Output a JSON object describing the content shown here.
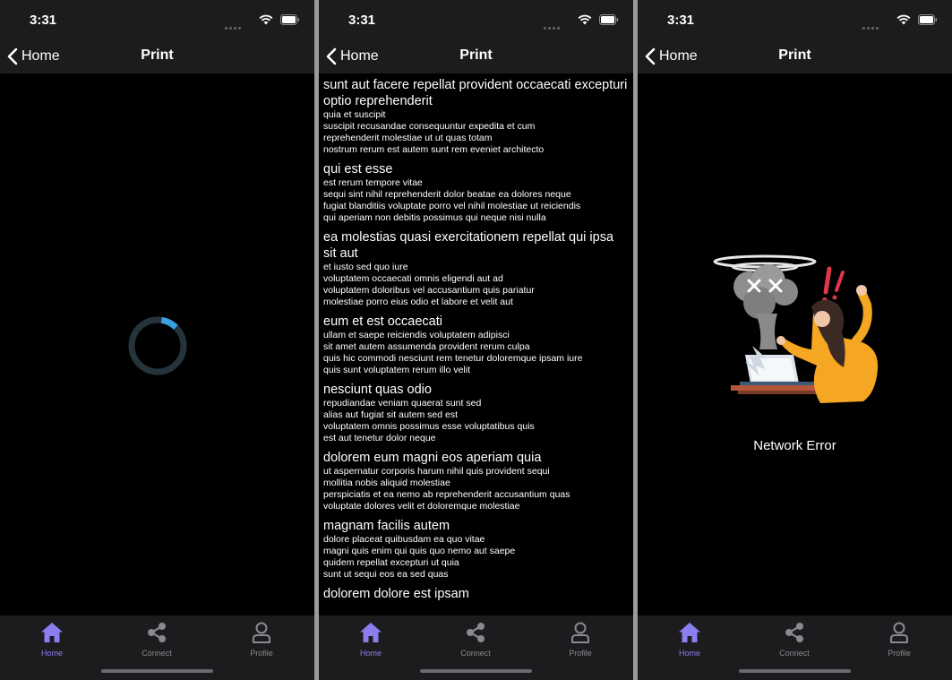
{
  "screens": [
    {
      "time": "3:31",
      "back_label": "Home",
      "title": "Print"
    },
    {
      "time": "3:31",
      "back_label": "Home",
      "title": "Print"
    },
    {
      "time": "3:31",
      "back_label": "Home",
      "title": "Print"
    }
  ],
  "posts": [
    {
      "title": "sunt aut facere repellat provident occaecati excepturi optio reprehenderit",
      "body": "quia et suscipit\nsuscipit recusandae consequuntur expedita et cum\nreprehenderit molestiae ut ut quas totam\nnostrum rerum est autem sunt rem eveniet architecto"
    },
    {
      "title": "qui est esse",
      "body": "est rerum tempore vitae\nsequi sint nihil reprehenderit dolor beatae ea dolores neque\nfugiat blanditiis voluptate porro vel nihil molestiae ut reiciendis\nqui aperiam non debitis possimus qui neque nisi nulla"
    },
    {
      "title": "ea molestias quasi exercitationem repellat qui ipsa sit aut",
      "body": "et iusto sed quo iure\nvoluptatem occaecati omnis eligendi aut ad\nvoluptatem doloribus vel accusantium quis pariatur\nmolestiae porro eius odio et labore et velit aut"
    },
    {
      "title": "eum et est occaecati",
      "body": "ullam et saepe reiciendis voluptatem adipisci\nsit amet autem assumenda provident rerum culpa\nquis hic commodi nesciunt rem tenetur doloremque ipsam iure\nquis sunt voluptatem rerum illo velit"
    },
    {
      "title": "nesciunt quas odio",
      "body": "repudiandae veniam quaerat sunt sed\nalias aut fugiat sit autem sed est\nvoluptatem omnis possimus esse voluptatibus quis\nest aut tenetur dolor neque"
    },
    {
      "title": "dolorem eum magni eos aperiam quia",
      "body": "ut aspernatur corporis harum nihil quis provident sequi\nmollitia nobis aliquid molestiae\nperspiciatis et ea nemo ab reprehenderit accusantium quas\nvoluptate dolores velit et doloremque molestiae"
    },
    {
      "title": "magnam facilis autem",
      "body": "dolore placeat quibusdam ea quo vitae\nmagni quis enim qui quis quo nemo aut saepe\nquidem repellat excepturi ut quia\nsunt ut sequi eos ea sed quas"
    },
    {
      "title": "dolorem dolore est ipsam",
      "body": ""
    }
  ],
  "error_text": "Network Error",
  "tabs": {
    "home": "Home",
    "connect": "Connect",
    "profile": "Profile"
  },
  "icons": {
    "back": "chevron-left-icon",
    "home": "home-icon",
    "connect": "share-icon",
    "profile": "user-icon",
    "wifi": "wifi-icon",
    "battery": "battery-icon"
  },
  "colors": {
    "accent": "#8b7ff0",
    "bar_bg": "#1c1c1e",
    "spinner": "#3aa0e0"
  },
  "loading_progress": 0.1
}
